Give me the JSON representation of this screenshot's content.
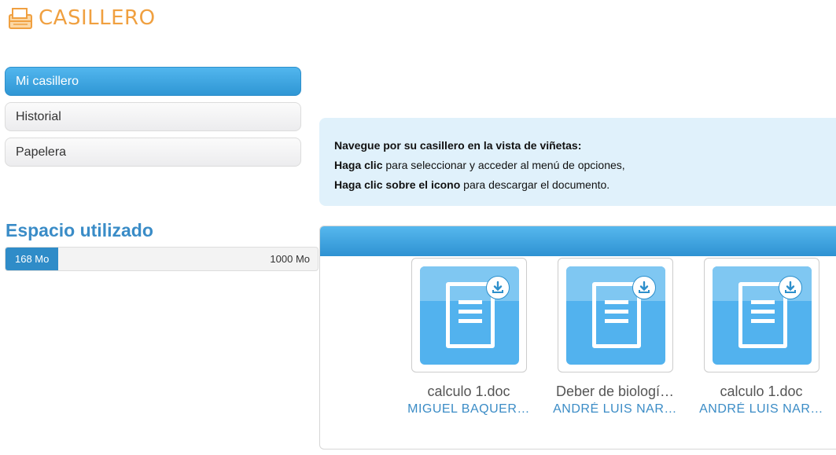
{
  "app": {
    "title": "CASILLERO",
    "logo_icon": "locker-tray-icon",
    "accent_color": "#f0a040"
  },
  "nav": {
    "items": [
      {
        "label": "Mi casillero",
        "active": true
      },
      {
        "label": "Historial",
        "active": false
      },
      {
        "label": "Papelera",
        "active": false
      }
    ]
  },
  "storage": {
    "title": "Espacio utilizado",
    "used_label": "168 Mo",
    "total_label": "1000 Mo",
    "used_fraction": 0.168
  },
  "info": {
    "line1_bold": "Navegue por su casillero en la vista de viñetas:",
    "line2_bold": "Haga clic",
    "line2_rest": " para seleccionar y acceder al menú de opciones,",
    "line3_bold": "Haga clic sobre el icono",
    "line3_rest": " para descargar el documento."
  },
  "files": [
    {
      "name": "calculo 1.doc",
      "owner": "MIGUEL BAQUER…",
      "icon": "document-icon",
      "download_icon": "download-icon"
    },
    {
      "name": "Deber de biologí…",
      "owner": "ANDRÉ LUIS NAR…",
      "icon": "document-icon",
      "download_icon": "download-icon"
    },
    {
      "name": "calculo 1.doc",
      "owner": "ANDRÉ LUIS NAR…",
      "icon": "document-icon",
      "download_icon": "download-icon"
    }
  ],
  "colors": {
    "primary_blue": "#2f96d4",
    "info_bg": "#e0f1fb",
    "thumb_blue": "#52b2ee"
  }
}
